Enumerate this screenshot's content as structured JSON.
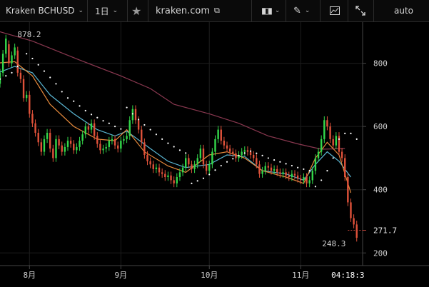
{
  "toolbar": {
    "symbol": "Kraken BCHUSD",
    "interval": "1日",
    "site": "kraken.com",
    "scale_mode": "auto",
    "icons": [
      "chevron-down-icon",
      "star-icon",
      "external-link-icon",
      "chart-style-icon",
      "pencil-icon",
      "indicator-icon",
      "fullscreen-icon"
    ]
  },
  "chart_data": {
    "type": "candlestick",
    "symbol": "BCHUSD",
    "x_ticks": [
      {
        "label": "8月",
        "day": 13
      },
      {
        "label": "9月",
        "day": 44
      },
      {
        "label": "10月",
        "day": 74
      },
      {
        "label": "11月",
        "day": 105
      }
    ],
    "cursor_label": "04:18:3",
    "cursor_day": 121,
    "y_ticks": [
      200,
      400,
      600,
      800
    ],
    "ylim": [
      160,
      930
    ],
    "xlim": [
      3,
      126
    ],
    "high_label": {
      "value": "878.2",
      "day": 6
    },
    "low_label": {
      "value": "248.3",
      "day": 121
    },
    "last_price": {
      "value": "271.7",
      "price": 271.7
    },
    "colors": {
      "up": "#33d74a",
      "down": "#e0523a",
      "ma_long": "#8a3850",
      "ma_mid": "#5ab6d2",
      "ma_short": "#e68a3c",
      "sar": "#ffffff",
      "grid": "#1d1d1d",
      "axis": "#444444",
      "last_line": "#c8463c"
    },
    "candles": [
      [
        735,
        770
      ],
      [
        770,
        830
      ],
      [
        830,
        878
      ],
      [
        860,
        800
      ],
      [
        800,
        825
      ],
      [
        825,
        850
      ],
      [
        840,
        770
      ],
      [
        770,
        750
      ],
      [
        750,
        690
      ],
      [
        690,
        700
      ],
      [
        700,
        640
      ],
      [
        640,
        610
      ],
      [
        610,
        580
      ],
      [
        580,
        550
      ],
      [
        550,
        520
      ],
      [
        520,
        560
      ],
      [
        560,
        580
      ],
      [
        580,
        530
      ],
      [
        530,
        500
      ],
      [
        500,
        560
      ],
      [
        560,
        540
      ],
      [
        540,
        520
      ],
      [
        520,
        535
      ],
      [
        535,
        555
      ],
      [
        555,
        545
      ],
      [
        545,
        525
      ],
      [
        525,
        535
      ],
      [
        535,
        555
      ],
      [
        555,
        575
      ],
      [
        575,
        600
      ],
      [
        600,
        590
      ],
      [
        590,
        610
      ],
      [
        610,
        570
      ],
      [
        570,
        545
      ],
      [
        545,
        525
      ],
      [
        525,
        530
      ],
      [
        530,
        535
      ],
      [
        535,
        555
      ],
      [
        555,
        560
      ],
      [
        560,
        540
      ],
      [
        540,
        530
      ],
      [
        530,
        555
      ],
      [
        555,
        560
      ],
      [
        560,
        570
      ],
      [
        570,
        620
      ],
      [
        620,
        655
      ],
      [
        655,
        620
      ],
      [
        620,
        590
      ],
      [
        590,
        550
      ],
      [
        550,
        510
      ],
      [
        510,
        490
      ],
      [
        490,
        480
      ],
      [
        480,
        465
      ],
      [
        465,
        470
      ],
      [
        470,
        455
      ],
      [
        455,
        450
      ],
      [
        450,
        440
      ],
      [
        440,
        445
      ],
      [
        445,
        430
      ],
      [
        430,
        420
      ],
      [
        420,
        440
      ],
      [
        440,
        455
      ],
      [
        455,
        470
      ],
      [
        470,
        500
      ],
      [
        500,
        480
      ],
      [
        480,
        465
      ],
      [
        465,
        480
      ],
      [
        480,
        500
      ],
      [
        500,
        530
      ],
      [
        530,
        480
      ],
      [
        480,
        460
      ],
      [
        460,
        480
      ],
      [
        480,
        520
      ],
      [
        520,
        560
      ],
      [
        560,
        590
      ],
      [
        590,
        555
      ],
      [
        555,
        540
      ],
      [
        540,
        530
      ],
      [
        530,
        520
      ],
      [
        520,
        515
      ],
      [
        515,
        500
      ],
      [
        500,
        510
      ],
      [
        510,
        520
      ],
      [
        520,
        525
      ],
      [
        525,
        520
      ],
      [
        520,
        510
      ],
      [
        510,
        500
      ],
      [
        500,
        480
      ],
      [
        480,
        450
      ],
      [
        450,
        460
      ],
      [
        460,
        475
      ],
      [
        475,
        470
      ],
      [
        470,
        460
      ],
      [
        460,
        465
      ],
      [
        465,
        455
      ],
      [
        455,
        450
      ],
      [
        450,
        455
      ],
      [
        455,
        445
      ],
      [
        445,
        440
      ],
      [
        440,
        450
      ],
      [
        450,
        445
      ],
      [
        445,
        435
      ],
      [
        435,
        430
      ],
      [
        430,
        440
      ],
      [
        440,
        420
      ],
      [
        420,
        430
      ],
      [
        430,
        460
      ],
      [
        460,
        500
      ],
      [
        500,
        520
      ],
      [
        520,
        560
      ],
      [
        560,
        620
      ],
      [
        620,
        600
      ],
      [
        600,
        560
      ],
      [
        560,
        540
      ],
      [
        540,
        570
      ],
      [
        570,
        520
      ],
      [
        520,
        500
      ],
      [
        500,
        440
      ],
      [
        440,
        360
      ],
      [
        360,
        310
      ],
      [
        310,
        290
      ],
      [
        290,
        248
      ]
    ],
    "ma_long_points": [
      [
        1,
        905
      ],
      [
        14,
        870
      ],
      [
        30,
        810
      ],
      [
        44,
        760
      ],
      [
        54,
        720
      ],
      [
        62,
        670
      ],
      [
        74,
        640
      ],
      [
        84,
        610
      ],
      [
        94,
        570
      ],
      [
        104,
        545
      ],
      [
        112,
        528
      ],
      [
        120,
        530
      ]
    ],
    "ma_mid_points": [
      [
        1,
        765
      ],
      [
        8,
        790
      ],
      [
        14,
        770
      ],
      [
        20,
        700
      ],
      [
        28,
        640
      ],
      [
        36,
        590
      ],
      [
        42,
        570
      ],
      [
        46,
        585
      ],
      [
        54,
        530
      ],
      [
        60,
        490
      ],
      [
        66,
        470
      ],
      [
        74,
        480
      ],
      [
        80,
        510
      ],
      [
        86,
        505
      ],
      [
        92,
        460
      ],
      [
        100,
        450
      ],
      [
        106,
        430
      ],
      [
        110,
        480
      ],
      [
        114,
        520
      ],
      [
        118,
        490
      ],
      [
        122,
        440
      ]
    ],
    "ma_short_points": [
      [
        1,
        800
      ],
      [
        8,
        805
      ],
      [
        14,
        760
      ],
      [
        20,
        670
      ],
      [
        28,
        600
      ],
      [
        36,
        560
      ],
      [
        42,
        555
      ],
      [
        46,
        590
      ],
      [
        52,
        520
      ],
      [
        60,
        475
      ],
      [
        66,
        455
      ],
      [
        74,
        510
      ],
      [
        80,
        520
      ],
      [
        86,
        500
      ],
      [
        92,
        460
      ],
      [
        100,
        440
      ],
      [
        106,
        420
      ],
      [
        110,
        500
      ],
      [
        114,
        550
      ],
      [
        118,
        510
      ],
      [
        122,
        390
      ]
    ],
    "sar_points": [
      [
        1,
        740
      ],
      [
        3,
        750
      ],
      [
        5,
        760
      ],
      [
        7,
        770
      ],
      [
        9,
        790
      ],
      [
        12,
        830
      ],
      [
        14,
        815
      ],
      [
        16,
        795
      ],
      [
        18,
        775
      ],
      [
        20,
        755
      ],
      [
        22,
        735
      ],
      [
        24,
        710
      ],
      [
        26,
        690
      ],
      [
        28,
        680
      ],
      [
        30,
        665
      ],
      [
        32,
        650
      ],
      [
        34,
        638
      ],
      [
        36,
        628
      ],
      [
        38,
        618
      ],
      [
        40,
        610
      ],
      [
        42,
        600
      ],
      [
        44,
        592
      ],
      [
        46,
        660
      ],
      [
        48,
        640
      ],
      [
        50,
        622
      ],
      [
        52,
        605
      ],
      [
        54,
        590
      ],
      [
        56,
        575
      ],
      [
        58,
        560
      ],
      [
        60,
        547
      ],
      [
        62,
        536
      ],
      [
        64,
        525
      ],
      [
        66,
        516
      ],
      [
        68,
        420
      ],
      [
        70,
        428
      ],
      [
        72,
        436
      ],
      [
        74,
        448
      ],
      [
        76,
        462
      ],
      [
        78,
        476
      ],
      [
        80,
        488
      ],
      [
        82,
        498
      ],
      [
        84,
        508
      ],
      [
        86,
        516
      ],
      [
        88,
        522
      ],
      [
        90,
        515
      ],
      [
        92,
        508
      ],
      [
        94,
        500
      ],
      [
        96,
        494
      ],
      [
        98,
        488
      ],
      [
        100,
        482
      ],
      [
        102,
        476
      ],
      [
        104,
        470
      ],
      [
        106,
        465
      ],
      [
        108,
        460
      ],
      [
        110,
        410
      ],
      [
        112,
        430
      ],
      [
        114,
        460
      ],
      [
        116,
        500
      ],
      [
        118,
        560
      ],
      [
        120,
        578
      ],
      [
        122,
        578
      ],
      [
        124,
        560
      ]
    ]
  }
}
